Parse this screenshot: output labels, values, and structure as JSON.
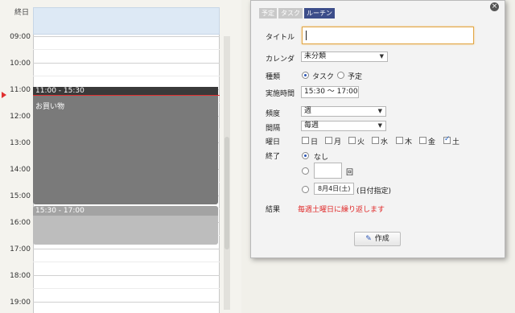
{
  "calendar": {
    "allday_label": "終日",
    "hours": [
      "09:00",
      "10:00",
      "11:00",
      "12:00",
      "13:00",
      "14:00",
      "15:00",
      "16:00",
      "17:00",
      "18:00",
      "19:00"
    ],
    "events": [
      {
        "time": "11:00 - 15:30",
        "title": "お買い物"
      },
      {
        "time": "15:30 - 17:00",
        "title": ""
      }
    ]
  },
  "dialog": {
    "tabs": [
      {
        "label": "予定",
        "active": false
      },
      {
        "label": "タスク",
        "active": false
      },
      {
        "label": "ルーチン",
        "active": true
      }
    ],
    "fields": {
      "title_label": "タイトル",
      "title_value": "",
      "calendar_label": "カレンダ",
      "calendar_value": "未分類",
      "type_label": "種類",
      "type_options": [
        "タスク",
        "予定"
      ],
      "type_selected": "タスク",
      "time_label": "実施時間",
      "time_value": "15:30 ～ 17:00",
      "frequency_label": "頻度",
      "frequency_value": "週",
      "interval_label": "間隔",
      "interval_value": "毎週",
      "weekday_label": "曜日",
      "weekdays": [
        {
          "label": "日",
          "checked": false
        },
        {
          "label": "月",
          "checked": false
        },
        {
          "label": "火",
          "checked": false
        },
        {
          "label": "水",
          "checked": false
        },
        {
          "label": "木",
          "checked": false
        },
        {
          "label": "金",
          "checked": false
        },
        {
          "label": "土",
          "checked": true
        }
      ],
      "end_label": "終了",
      "end_none": "なし",
      "end_count_unit": "回",
      "end_date_value": "8月4日(土)",
      "end_date_suffix": "(日付指定)",
      "result_label": "結果",
      "result_value": "毎週土曜日に繰り返します"
    },
    "create_button": "作成"
  },
  "colors": {
    "now_line": "#e03030",
    "event_dark": "#7a7a7a",
    "event_light": "#bdbdbd",
    "active_tab": "#3c4d8a",
    "result_text": "#e02828"
  }
}
